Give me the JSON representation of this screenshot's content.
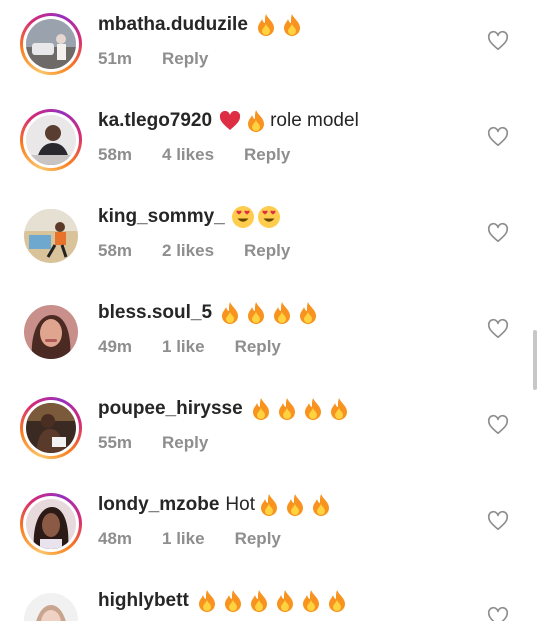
{
  "colors": {
    "text": "#262626",
    "secondary": "#8e8e8e",
    "heart_outline": "#8e8e8e",
    "story_ring": [
      "#fdc468",
      "#fa7e1e",
      "#d62976",
      "#962fbf"
    ]
  },
  "comments": [
    {
      "username": "mbatha.duduzile",
      "text": "",
      "emojis": [
        "fire-emoji",
        "fire-emoji"
      ],
      "time": "51m",
      "likes": "",
      "reply": "Reply",
      "ring": true
    },
    {
      "username": "ka.tlego7920",
      "text": "role model",
      "emojis": [
        "red-heart-emoji",
        "fire-emoji"
      ],
      "time": "58m",
      "likes": "4 likes",
      "reply": "Reply",
      "ring": true
    },
    {
      "username": "king_sommy_",
      "text": "",
      "emojis": [
        "heart-eyes-emoji",
        "heart-eyes-emoji"
      ],
      "time": "58m",
      "likes": "2 likes",
      "reply": "Reply",
      "ring": false
    },
    {
      "username": "bless.soul_5",
      "text": "",
      "emojis": [
        "fire-emoji",
        "fire-emoji",
        "fire-emoji",
        "fire-emoji"
      ],
      "time": "49m",
      "likes": "1 like",
      "reply": "Reply",
      "ring": false
    },
    {
      "username": "poupee_hirysse",
      "text": "",
      "emojis": [
        "fire-emoji",
        "fire-emoji",
        "fire-emoji",
        "fire-emoji"
      ],
      "time": "55m",
      "likes": "",
      "reply": "Reply",
      "ring": true
    },
    {
      "username": "londy_mzobe",
      "text": "Hot",
      "emojis": [
        "fire-emoji",
        "fire-emoji",
        "fire-emoji"
      ],
      "time": "48m",
      "likes": "1 like",
      "reply": "Reply",
      "ring": true
    },
    {
      "username": "highlybett",
      "text": "",
      "emojis": [
        "fire-emoji",
        "fire-emoji",
        "fire-emoji",
        "fire-emoji",
        "fire-emoji",
        "fire-emoji"
      ],
      "time": "",
      "likes": "",
      "reply": "",
      "ring": false
    }
  ]
}
